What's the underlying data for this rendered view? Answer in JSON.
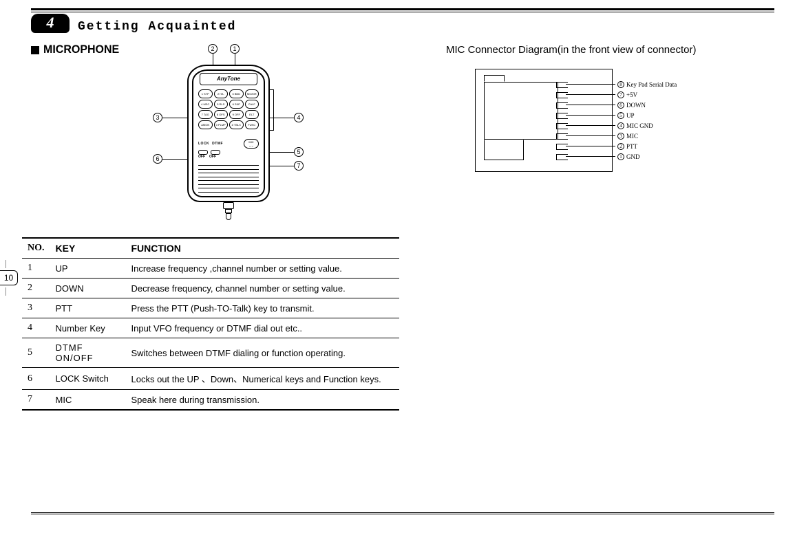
{
  "chapter": {
    "number": "4",
    "title": "Getting Acquainted"
  },
  "section": {
    "title": "MICROPHONE"
  },
  "page_number": "10",
  "right_heading": "MIC Connector Diagram(in the front view of connector)",
  "mic": {
    "brand": "AnyTone",
    "keypad": [
      "1 STP SET",
      "2 H/L TSQ",
      "3 BND TSC",
      "MO/MR",
      "4 MSC SQL",
      "5 RLS BSY",
      "6 SKP SVC",
      "CALF CALL",
      "7 TAG TOT",
      "8 OFS REV",
      "9 OFF SFT",
      "ELT SCAL",
      "AMON BMON",
      "0 PLMP MUTE",
      "# TBLX CANC",
      "FUNC"
    ],
    "lower_labels": {
      "lock": "LOCK",
      "dtmf": "DTMF",
      "mic": "MIC",
      "off": "OFF"
    },
    "callouts": {
      "c1": "1",
      "c2": "2",
      "c3": "3",
      "c4": "4",
      "c5": "5",
      "c6": "6",
      "c7": "7"
    }
  },
  "table": {
    "headers": {
      "no": "NO.",
      "key": "KEY",
      "function": "FUNCTION"
    },
    "rows": [
      {
        "no": "1",
        "key": "UP",
        "function": "Increase frequency ,channel number or setting value."
      },
      {
        "no": "2",
        "key": "DOWN",
        "function": "Decrease frequency, channel number or setting value."
      },
      {
        "no": "3",
        "key": "PTT",
        "function": "Press the PTT (Push-TO-Talk) key to transmit."
      },
      {
        "no": "4",
        "key": "Number Key",
        "function": "Input VFO frequency or DTMF dial out etc.."
      },
      {
        "no": "5",
        "key": "DTMF ON/OFF",
        "function": "Switches between DTMF dialing or function operating.",
        "justify": true
      },
      {
        "no": "6",
        "key": "LOCK Switch",
        "function": "Locks out the UP 、Down、Numerical keys and Function keys."
      },
      {
        "no": "7",
        "key": "MIC",
        "function": "Speak here during transmission."
      }
    ]
  },
  "connector": {
    "pins": [
      {
        "num": "8",
        "label": "Key Pad Serial Data"
      },
      {
        "num": "7",
        "label": "+5V"
      },
      {
        "num": "6",
        "label": "DOWN"
      },
      {
        "num": "5",
        "label": "UP"
      },
      {
        "num": "4",
        "label": "MIC GND"
      },
      {
        "num": "3",
        "label": "MIC"
      },
      {
        "num": "2",
        "label": "PTT"
      },
      {
        "num": "1",
        "label": "GND"
      }
    ]
  }
}
